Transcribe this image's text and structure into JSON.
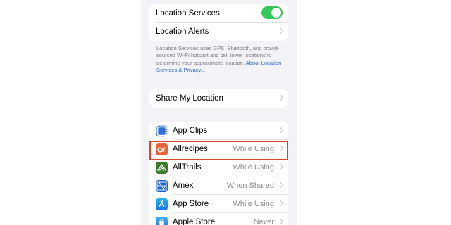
{
  "settings": {
    "location_services": {
      "label": "Location Services",
      "toggle_on": true
    },
    "location_alerts": {
      "label": "Location Alerts"
    },
    "footnote": {
      "text": "Location Services uses GPS, Bluetooth, and crowd-sourced Wi-Fi hotspot and cell tower locations to determine your approximate location. ",
      "link": "About Location Services & Privacy..."
    },
    "share_my_location": {
      "label": "Share My Location"
    },
    "apps": [
      {
        "name": "App Clips",
        "value": "",
        "icon": "app-clips-icon"
      },
      {
        "name": "Allrecipes",
        "value": "While Using",
        "icon": "allrecipes-icon"
      },
      {
        "name": "AllTrails",
        "value": "While Using",
        "icon": "alltrails-icon"
      },
      {
        "name": "Amex",
        "value": "When Shared",
        "icon": "amex-icon"
      },
      {
        "name": "App Store",
        "value": "While Using",
        "icon": "app-store-icon"
      },
      {
        "name": "Apple Store",
        "value": "Never",
        "icon": "apple-store-icon"
      }
    ]
  },
  "colors": {
    "toggle_on": "#34c759",
    "link": "#2f6fd6",
    "highlight_border": "#d9472b",
    "background": "#f2f2f7"
  }
}
